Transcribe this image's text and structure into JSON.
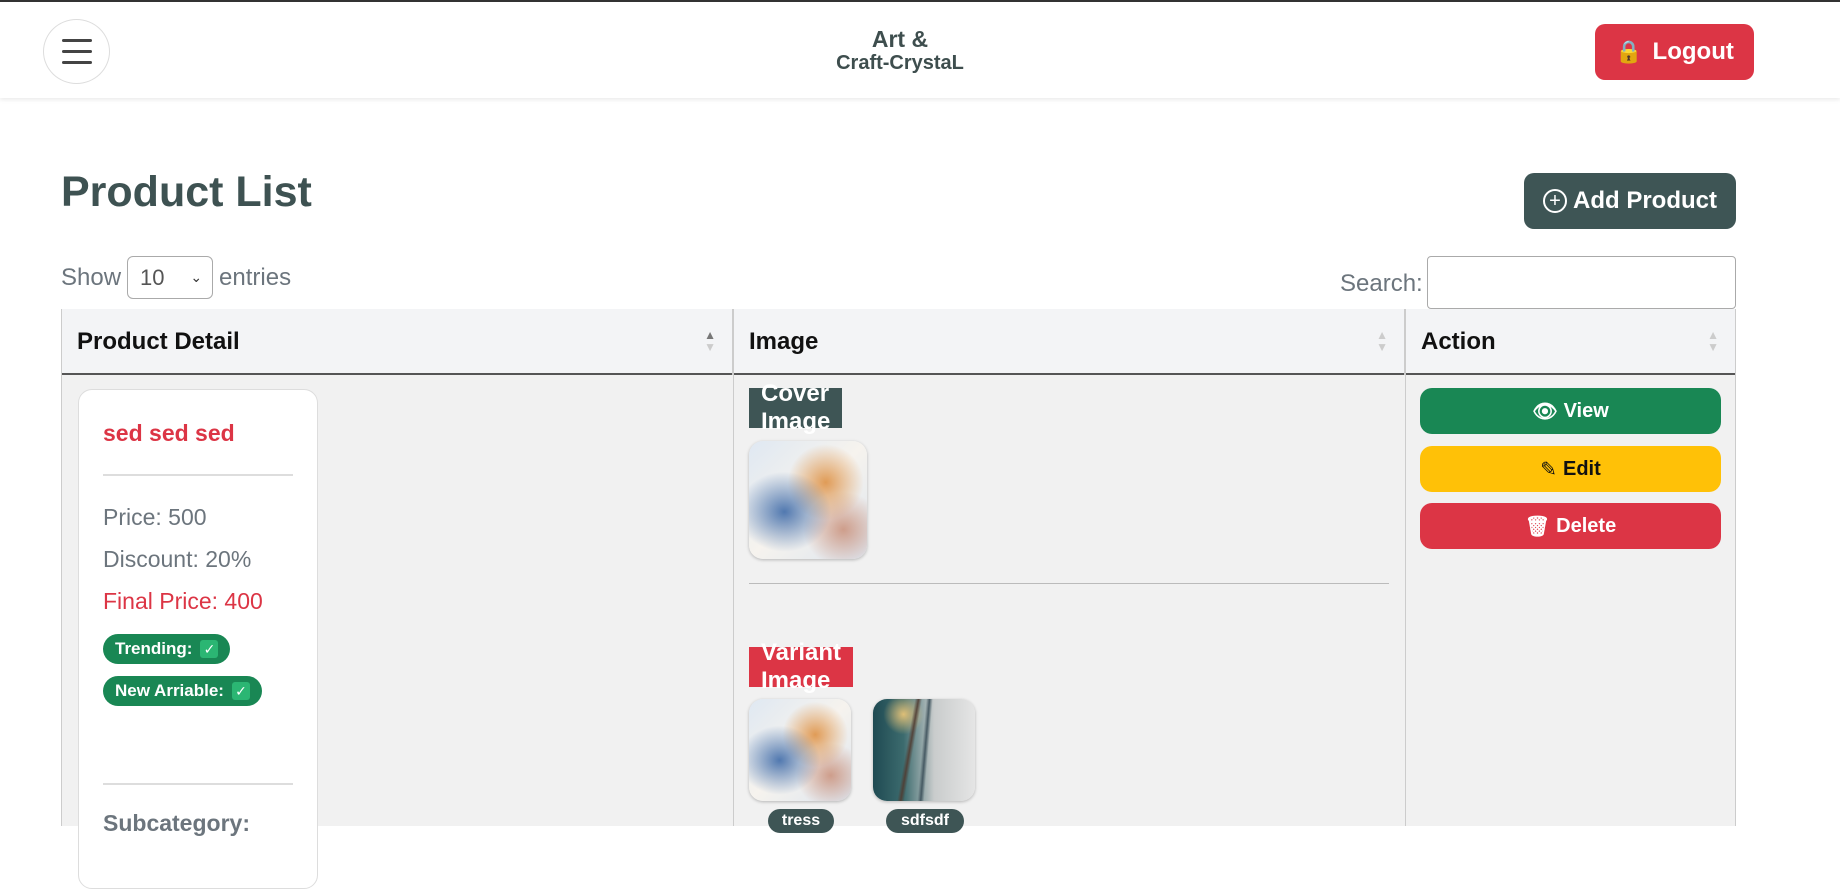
{
  "header": {
    "brand_line1": "Art &",
    "brand_line2": "Craft-CrystaL",
    "logout_label": "Logout",
    "logout_icon": "lock-icon"
  },
  "page": {
    "title": "Product List",
    "add_product_label": "Add Product"
  },
  "controls": {
    "show_label": "Show",
    "entries_value": "10",
    "entries_label": "entries",
    "search_label": "Search:",
    "search_value": ""
  },
  "table": {
    "columns": [
      "Product Detail",
      "Image",
      "Action"
    ],
    "rows": [
      {
        "name": "sed sed sed",
        "price": "Price: 500",
        "discount": "Discount: 20%",
        "final_price": "Final Price: 400",
        "trending_label": "Trending:",
        "trending": true,
        "new_arrival_label": "New Arriable:",
        "new_arrival": true,
        "subcategory_label": "Subcategory:",
        "cover_label": "Cover Image",
        "variant_label": "Variant Image",
        "variants": [
          "tress",
          "sdfsdf"
        ],
        "actions": {
          "view": "View",
          "edit": "Edit",
          "delete": "Delete"
        }
      }
    ]
  },
  "colors": {
    "primary_dark": "#3e5555",
    "danger": "#dc3545",
    "success": "#198754",
    "warning": "#ffc107"
  }
}
